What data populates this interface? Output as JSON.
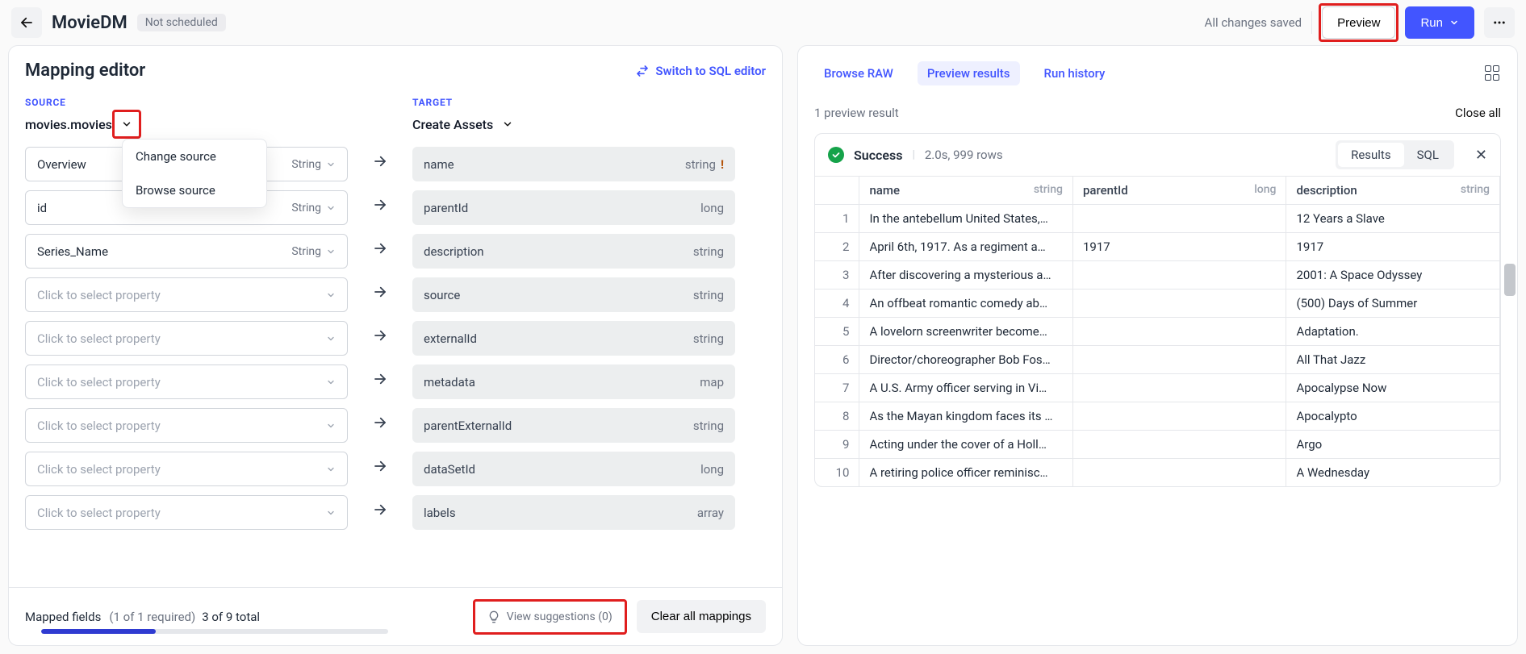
{
  "header": {
    "title": "MovieDM",
    "schedule_badge": "Not scheduled",
    "saved": "All changes saved",
    "preview": "Preview",
    "run": "Run"
  },
  "left": {
    "title": "Mapping editor",
    "switch_link": "Switch to SQL editor",
    "source_label": "SOURCE",
    "source_name": "movies.movies",
    "target_label": "TARGET",
    "target_name": "Create Assets",
    "dropdown": {
      "change": "Change source",
      "browse": "Browse source"
    },
    "placeholder": "Click to select property",
    "type_string": "String",
    "source_rows": [
      {
        "name": "Overview",
        "type": "String"
      },
      {
        "name": "id",
        "type": "String"
      },
      {
        "name": "Series_Name",
        "type": "String"
      },
      null,
      null,
      null,
      null,
      null,
      null
    ],
    "target_rows": [
      {
        "name": "name",
        "type": "string",
        "warn": true
      },
      {
        "name": "parentId",
        "type": "long"
      },
      {
        "name": "description",
        "type": "string"
      },
      {
        "name": "source",
        "type": "string"
      },
      {
        "name": "externalId",
        "type": "string"
      },
      {
        "name": "metadata",
        "type": "map"
      },
      {
        "name": "parentExternalId",
        "type": "string"
      },
      {
        "name": "dataSetId",
        "type": "long"
      },
      {
        "name": "labels",
        "type": "array"
      }
    ],
    "footer": {
      "mapped": "Mapped fields",
      "required": "(1 of 1 required)",
      "total": "3 of 9 total",
      "suggestions": "View suggestions (0)",
      "clear": "Clear all mappings"
    }
  },
  "right": {
    "tabs": {
      "raw": "Browse RAW",
      "preview": "Preview results",
      "history": "Run history"
    },
    "summary": "1 preview result",
    "close_all": "Close all",
    "success": "Success",
    "meta": "2.0s, 999 rows",
    "pills": {
      "results": "Results",
      "sql": "SQL"
    },
    "columns": [
      {
        "name": "name",
        "type": "string"
      },
      {
        "name": "parentId",
        "type": "long"
      },
      {
        "name": "description",
        "type": "string"
      }
    ],
    "rows": [
      {
        "idx": 1,
        "name": "In the antebellum United States,…",
        "parentId": "",
        "description": "12 Years a Slave"
      },
      {
        "idx": 2,
        "name": "April 6th, 1917. As a regiment a…",
        "parentId": "1917",
        "description": "1917"
      },
      {
        "idx": 3,
        "name": "After discovering a mysterious a…",
        "parentId": "",
        "description": "2001: A Space Odyssey"
      },
      {
        "idx": 4,
        "name": "An offbeat romantic comedy ab…",
        "parentId": "",
        "description": "(500) Days of Summer"
      },
      {
        "idx": 5,
        "name": "A lovelorn screenwriter become…",
        "parentId": "",
        "description": "Adaptation."
      },
      {
        "idx": 6,
        "name": "Director/choreographer Bob Fos…",
        "parentId": "",
        "description": "All That Jazz"
      },
      {
        "idx": 7,
        "name": "A U.S. Army officer serving in Vi…",
        "parentId": "",
        "description": "Apocalypse Now"
      },
      {
        "idx": 8,
        "name": "As the Mayan kingdom faces its …",
        "parentId": "",
        "description": "Apocalypto"
      },
      {
        "idx": 9,
        "name": "Acting under the cover of a Holl…",
        "parentId": "",
        "description": "Argo"
      },
      {
        "idx": 10,
        "name": "A retiring police officer reminisc…",
        "parentId": "",
        "description": "A Wednesday"
      }
    ]
  }
}
